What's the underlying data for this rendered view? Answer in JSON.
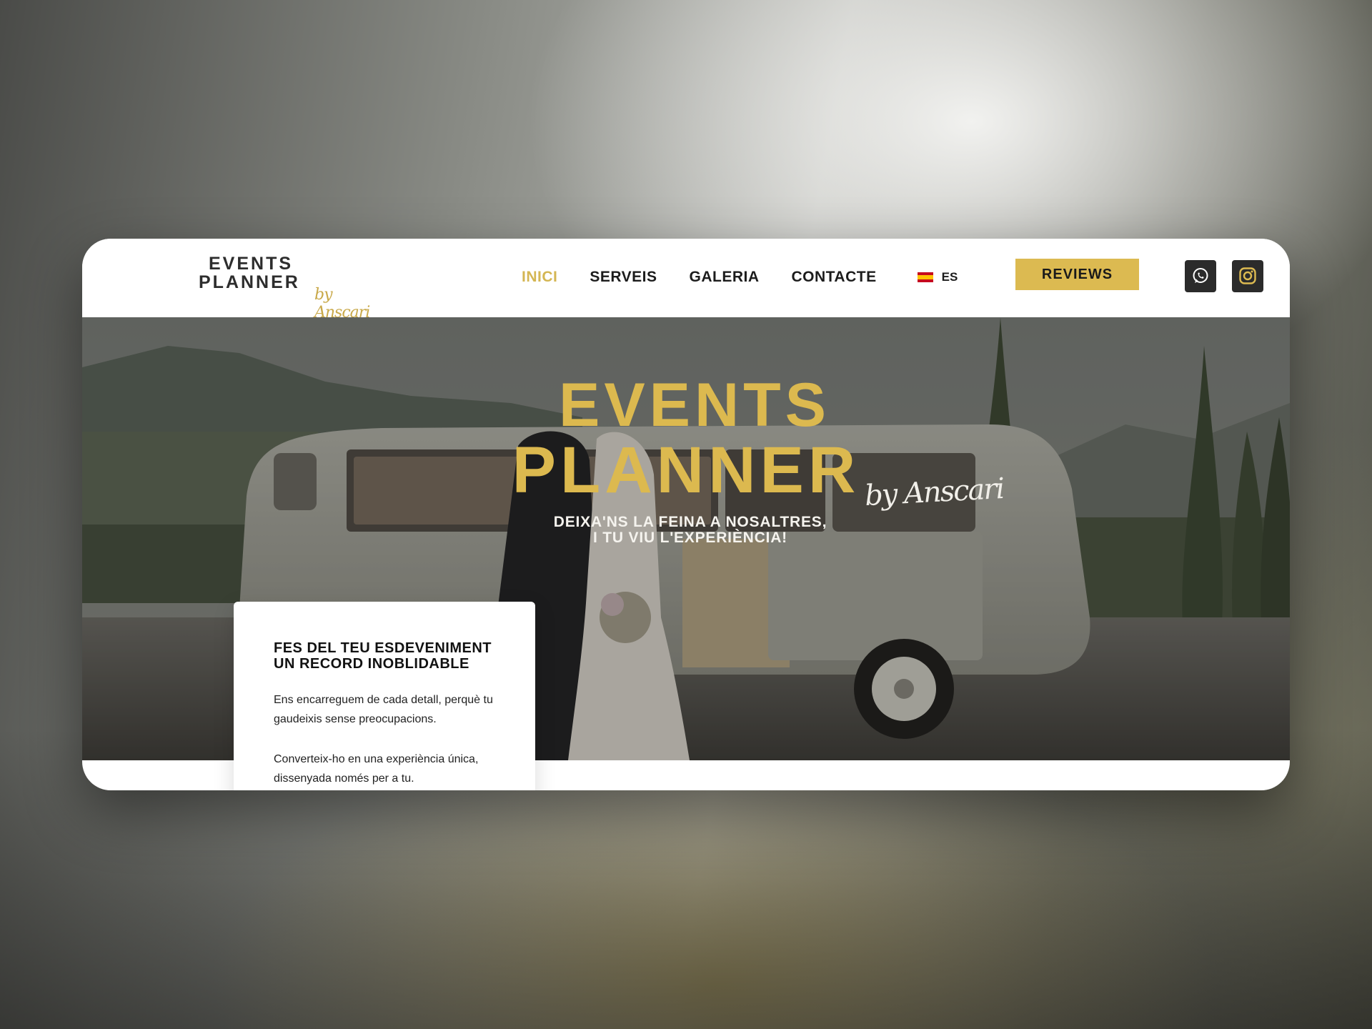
{
  "brand": {
    "logo_line1": "EVENTS",
    "logo_line2": "PLANNER",
    "logo_by": "by Anscari",
    "accent_color": "#dcba51"
  },
  "nav": {
    "items": [
      {
        "label": "INICI",
        "active": true
      },
      {
        "label": "SERVEIS",
        "active": false
      },
      {
        "label": "GALERIA",
        "active": false
      },
      {
        "label": "CONTACTE",
        "active": false
      }
    ],
    "language": {
      "flag": "spain-flag-icon",
      "label": "ES"
    },
    "reviews_label": "REVIEWS",
    "social": [
      {
        "name": "whatsapp-icon"
      },
      {
        "name": "instagram-icon"
      }
    ]
  },
  "hero": {
    "title_line1": "EVENTS",
    "title_line2": "PLANNER",
    "title_by": "by Anscari",
    "tagline_line1": "DEIXA'NS LA FEINA A NOSALTRES,",
    "tagline_line2": "I TU VIU L'EXPERIÈNCIA!"
  },
  "card": {
    "title": "FES DEL TEU ESDEVENIMENT UN RECORD INOBLIDABLE",
    "paragraph1": "Ens encarreguem de cada detall, perquè tu gaudeixis sense preocupacions.",
    "paragraph2": "Converteix-ho en una experiència única, dissenyada només per a tu."
  }
}
